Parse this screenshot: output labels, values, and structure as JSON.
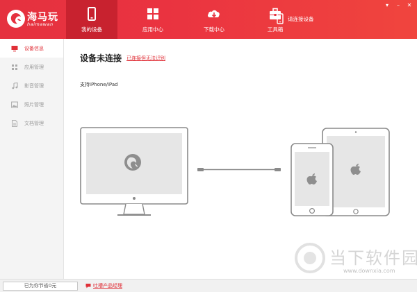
{
  "app": {
    "logo_text": "海马玩",
    "logo_subtitle": "haimawan"
  },
  "nav": {
    "items": [
      {
        "label": "我的设备",
        "icon": "phone-icon",
        "active": true
      },
      {
        "label": "应用中心",
        "icon": "apps-grid-icon",
        "active": false
      },
      {
        "label": "下载中心",
        "icon": "cloud-download-icon",
        "active": false
      },
      {
        "label": "工具箱",
        "icon": "toolbox-icon",
        "active": false
      }
    ],
    "connect_label": "请连接设备"
  },
  "window_controls": {
    "menu": "▾",
    "minimize": "–",
    "close": "✕"
  },
  "sidebar": {
    "items": [
      {
        "label": "设备信息",
        "icon": "monitor-icon",
        "active": true
      },
      {
        "label": "应用管理",
        "icon": "grid-icon",
        "active": false
      },
      {
        "label": "影音管理",
        "icon": "music-note-icon",
        "active": false
      },
      {
        "label": "照片管理",
        "icon": "image-icon",
        "active": false
      },
      {
        "label": "文档管理",
        "icon": "document-icon",
        "active": false
      }
    ]
  },
  "main": {
    "title": "设备未连接",
    "title_link": "已连接但无法识别",
    "support_text": "支持iPhone/iPad"
  },
  "footer": {
    "saved_text": "已为你节省0元",
    "feedback_label": "吐槽产品经理"
  },
  "watermark": {
    "text": "当下软件园",
    "url": "www.downxia.com"
  },
  "colors": {
    "brand_red": "#e5313f",
    "active_tab": "#c8222f",
    "link_red": "#e03038",
    "device_gray": "#8a8a8a"
  }
}
